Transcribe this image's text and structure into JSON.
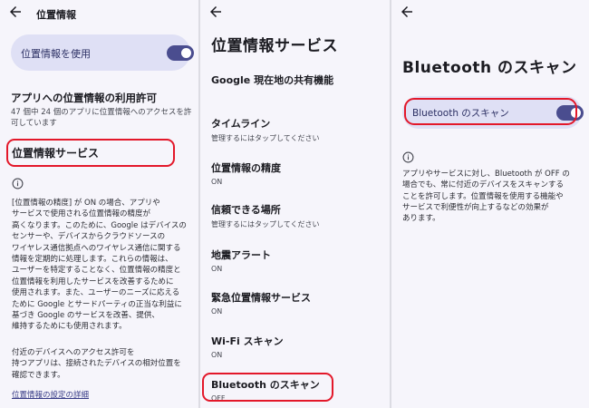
{
  "panel1": {
    "topbar_title": "位置情報",
    "toggle_label": "位置情報を使用",
    "toggle_state": "on",
    "app_permission_title": "アプリへの位置情報の利用許可",
    "app_permission_sub": "47 個中 24 個のアプリに位置情報へのアクセスを許可しています",
    "location_services_label": "位置情報サービス",
    "info_text": "[位置情報の精度] が ON の場合、アプリや\nサービスで使用される位置情報の精度が\n高くなります。このために、Google はデバイスの\nセンサーや、デバイスからクラウドソースの\nワイヤレス通信拠点へのワイヤレス通信に関する\n情報を定期的に処理します。これらの情報は、\nユーザーを特定することなく、位置情報の精度と\n位置情報を利用したサービスを改善するために\n使用されます。また、ユーザーのニーズに応える\nために Google とサードパーティの正当な利益に\n基づき Google のサービスを改善、提供、\n維持するためにも使用されます。",
    "nearby_text": "付近のデバイスへのアクセス許可を\n持つアプリは、接続されたデバイスの相対位置を\n確認できます。",
    "settings_link": "位置情報の設定の詳細"
  },
  "panel2": {
    "title": "位置情報サービス",
    "items": [
      {
        "title": "Google 現在地の共有機能",
        "sub": ""
      },
      {
        "title": "タイムライン",
        "sub": "管理するにはタップしてください"
      },
      {
        "title": "位置情報の精度",
        "sub": "ON"
      },
      {
        "title": "信頼できる場所",
        "sub": "管理するにはタップしてください"
      },
      {
        "title": "地震アラート",
        "sub": "ON"
      },
      {
        "title": "緊急位置情報サービス",
        "sub": "ON"
      },
      {
        "title": "Wi-Fi スキャン",
        "sub": "ON"
      },
      {
        "title": "Bluetooth のスキャン",
        "sub": "OFF"
      }
    ]
  },
  "panel3": {
    "title": "Bluetooth のスキャン",
    "toggle_label": "Bluetooth のスキャン",
    "toggle_state": "on",
    "description": "アプリやサービスに対し、Bluetooth が OFF の\n場合でも、常に付近のデバイスをスキャンする\nことを許可します。位置情報を使用する機能や\nサービスで利便性が向上するなどの効果が\nあります。"
  },
  "colors": {
    "highlight": "#e3182a",
    "switch_track": "#4a4d8f",
    "card_bg": "#dfe0f5",
    "panel_bg": "#f6f5fb"
  },
  "icons": [
    "back-arrow-icon",
    "info-icon",
    "toggle-switch"
  ]
}
